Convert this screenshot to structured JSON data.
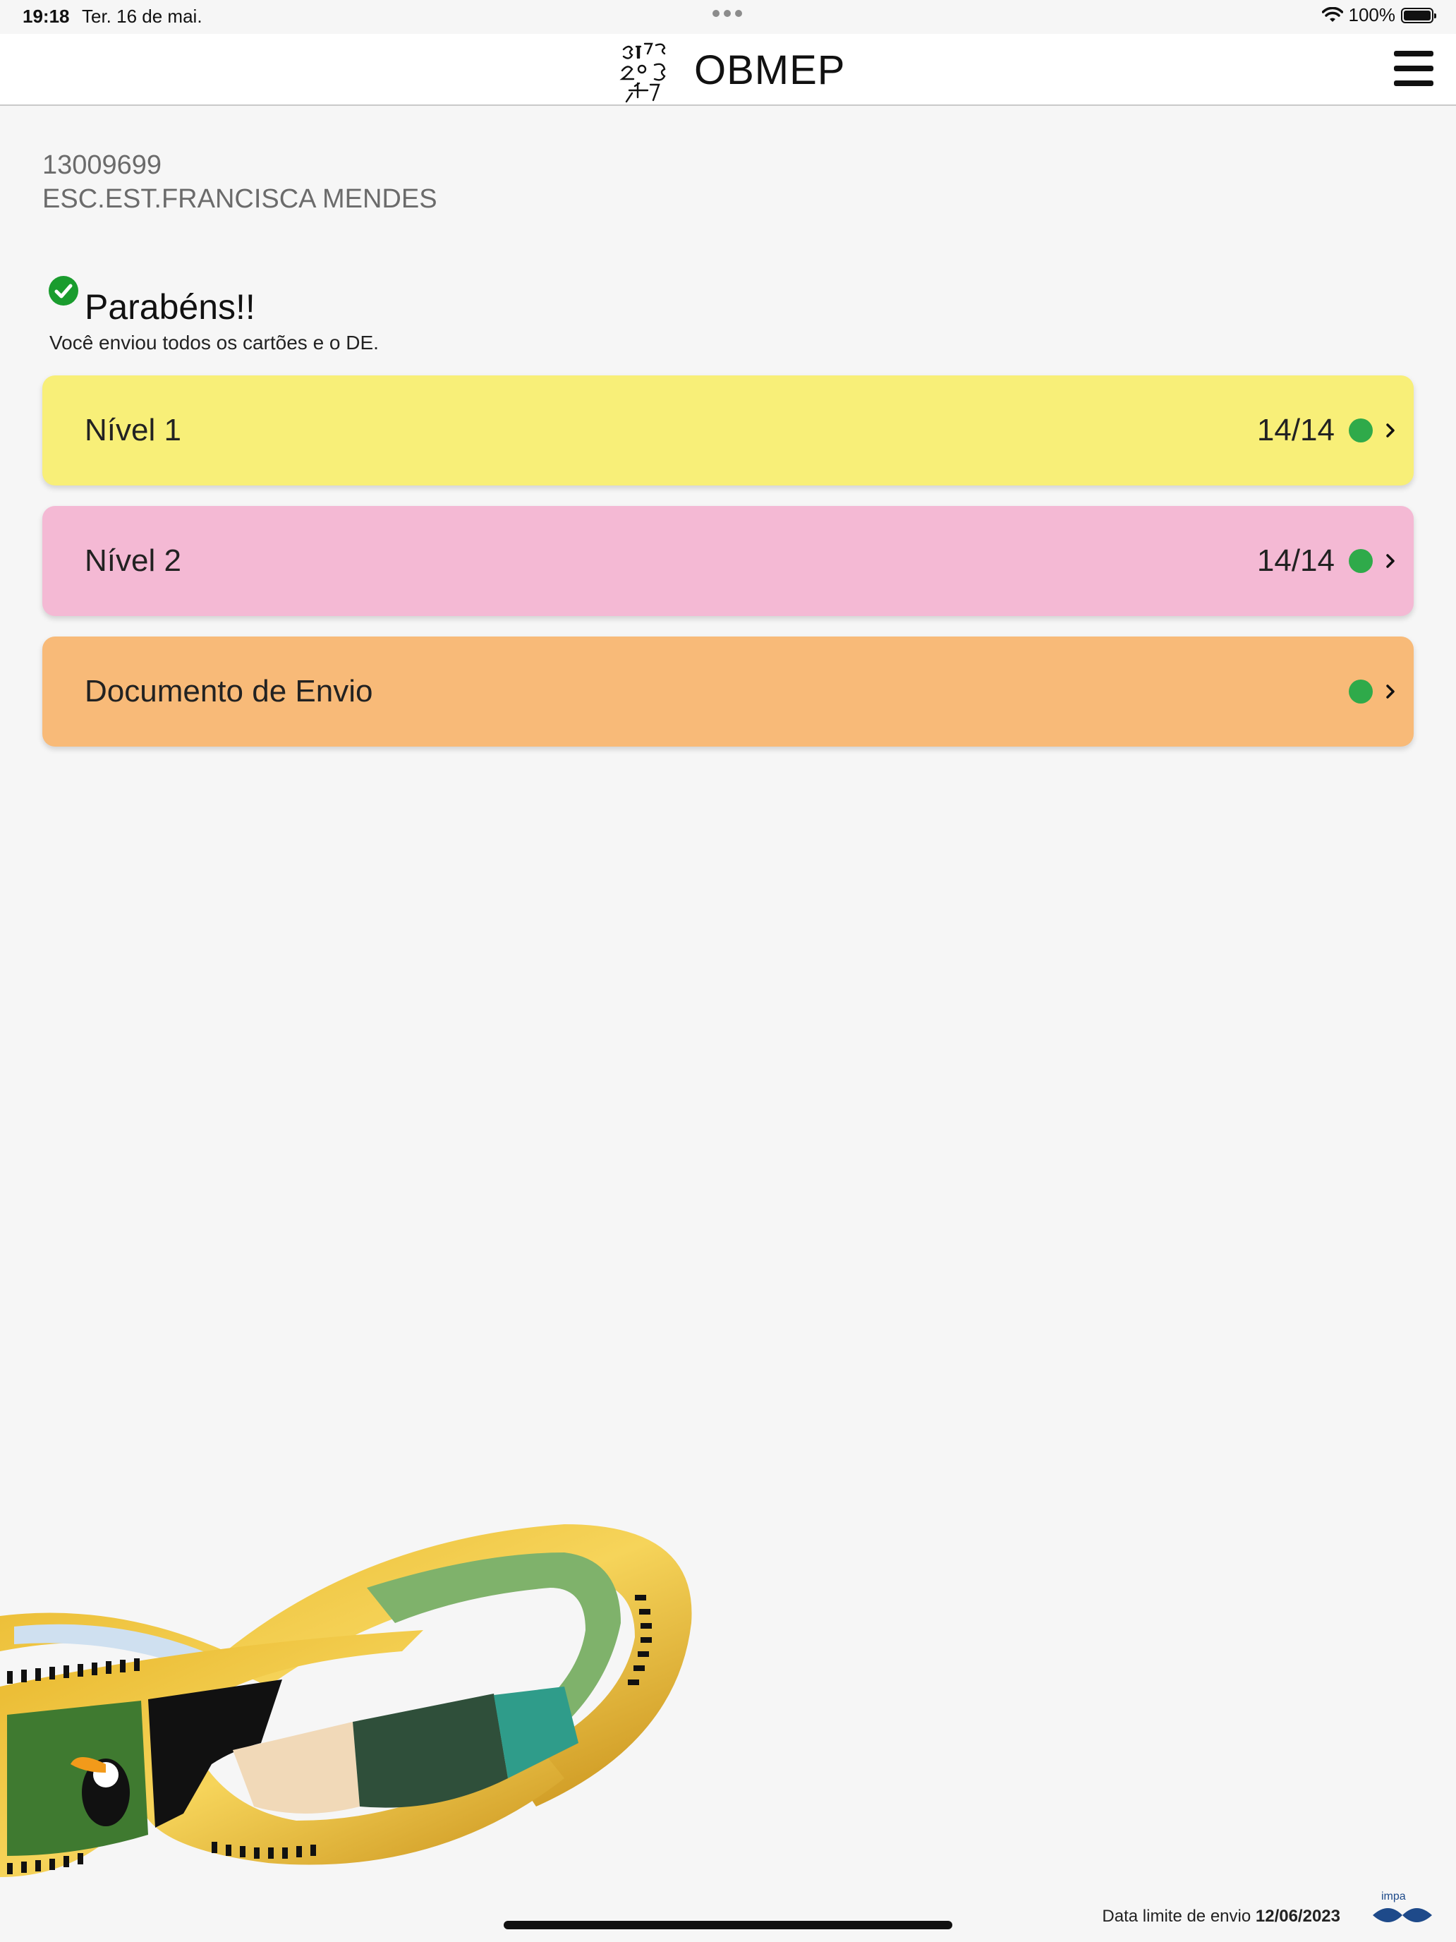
{
  "status_bar": {
    "time": "19:18",
    "date": "Ter. 16 de mai.",
    "battery": "100%"
  },
  "header": {
    "title": "OBMEP",
    "logo_icon": "obmep-logo",
    "menu_icon": "hamburger-menu-icon"
  },
  "school": {
    "code": "13009699",
    "name": "ESC.EST.FRANCISCA MENDES"
  },
  "status": {
    "title": "Parabéns!!",
    "message": "Você enviou todos os cartões e o DE.",
    "icon": "check-circle-icon",
    "color": "#1a9c2e"
  },
  "cards": [
    {
      "label": "Nível 1",
      "count": "14/14",
      "color": "#f8ef78",
      "status_color": "#2faa4a"
    },
    {
      "label": "Nível 2",
      "count": "14/14",
      "color": "#f4b9d4",
      "status_color": "#2faa4a"
    },
    {
      "label": "Documento de Envio",
      "count": "",
      "color": "#f8ba78",
      "status_color": "#2faa4a"
    }
  ],
  "footer": {
    "deadline_label": "Data limite de envio",
    "deadline_date": "12/06/2023",
    "brand": "impa"
  }
}
